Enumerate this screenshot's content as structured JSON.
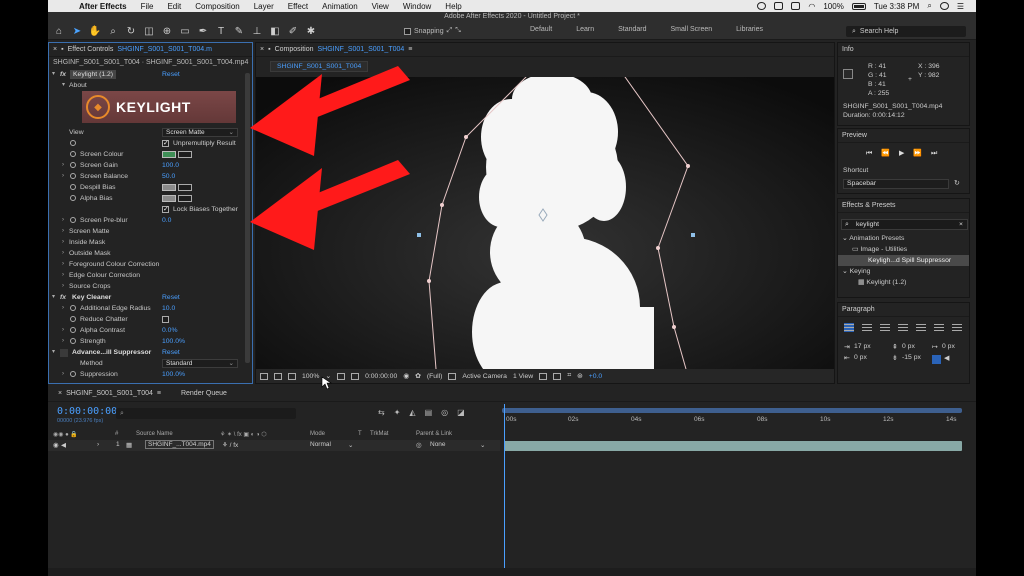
{
  "menubar": {
    "app_name": "After Effects",
    "items": [
      "File",
      "Edit",
      "Composition",
      "Layer",
      "Effect",
      "Animation",
      "View",
      "Window",
      "Help"
    ],
    "battery": "100%",
    "clock": "Tue 3:38 PM"
  },
  "window_title": "Adobe After Effects 2020 - Untitled Project *",
  "toolbar": {
    "snapping_label": "Snapping",
    "workspaces": [
      "Default",
      "Learn",
      "Standard",
      "Small Screen",
      "Libraries"
    ],
    "search_help_placeholder": "Search Help"
  },
  "effect_controls": {
    "header_label": "Effect Controls",
    "header_layer": "SHGINF_S001_S001_T004.m",
    "subheader": "SHGINF_S001_S001_T004 · SHGINF_S001_S001_T004.mp4",
    "keylight_name": "Keylight (1.2)",
    "reset_label": "Reset",
    "about_label": "About",
    "logo_text": "KEYLIGHT",
    "view_label": "View",
    "view_value": "Screen Matte",
    "unpremultiply_label": "Unpremultiply Result",
    "screen_colour_label": "Screen Colour",
    "screen_gain_label": "Screen Gain",
    "screen_gain_value": "100.0",
    "screen_balance_label": "Screen Balance",
    "screen_balance_value": "50.0",
    "despill_bias_label": "Despill Bias",
    "alpha_bias_label": "Alpha Bias",
    "lock_biases_label": "Lock Biases Together",
    "screen_preblur_label": "Screen Pre-blur",
    "screen_preblur_value": "0.0",
    "groups": [
      "Screen Matte",
      "Inside Mask",
      "Outside Mask",
      "Foreground Colour Correction",
      "Edge Colour Correction",
      "Source Crops"
    ],
    "key_cleaner_name": "Key Cleaner",
    "additional_edge_radius_label": "Additional Edge Radius",
    "additional_edge_radius_value": "10.0",
    "reduce_chatter_label": "Reduce Chatter",
    "alpha_contrast_label": "Alpha Contrast",
    "alpha_contrast_value": "0.0%",
    "strength_label": "Strength",
    "strength_value": "100.0%",
    "spill_suppressor_name": "Advance...ill Suppressor",
    "method_label": "Method",
    "method_value": "Standard",
    "suppression_label": "Suppression",
    "suppression_value": "100.0%"
  },
  "composition": {
    "header_label": "Composition",
    "header_comp": "SHGINF_S001_S001_T004",
    "tab_label": "SHGINF_S001_S001_T004",
    "zoom": "100%",
    "timecode": "0:00:00:00",
    "resolution": "(Full)",
    "camera": "Active Camera",
    "views": "1 View",
    "exposure": "+0.0"
  },
  "info": {
    "title": "Info",
    "r": "R : 41",
    "g": "G : 41",
    "b": "B : 41",
    "a": "A : 255",
    "x": "X : 396",
    "y": "Y : 982",
    "file": "SHGINF_S001_S001_T004.mp4",
    "duration": "Duration: 0:00:14:12"
  },
  "preview": {
    "title": "Preview",
    "shortcut_label": "Shortcut",
    "shortcut_value": "Spacebar"
  },
  "effects_presets": {
    "title": "Effects & Presets",
    "search_value": "keylight",
    "tree": [
      "Animation Presets",
      "Image - Utilities",
      "Keyligh...d Spill Suppressor",
      "Keying",
      "Keylight (1.2)"
    ]
  },
  "paragraph": {
    "title": "Paragraph",
    "indent_left": "17 px",
    "indent_right": "0 px",
    "space_before": "0 px",
    "first_line": "0 px",
    "space_after": "-15 px"
  },
  "timeline": {
    "tab_label": "SHGINF_S001_S001_T004",
    "render_queue_label": "Render Queue",
    "timecode": "0:00:00:00",
    "fps": "00000 (23.976 fps)",
    "columns": {
      "num": "#",
      "source": "Source Name",
      "mode": "Mode",
      "t": "T",
      "trkmat": "TrkMat",
      "parent": "Parent & Link"
    },
    "layer": {
      "index": "1",
      "name": "SHGINF_...T004.mp4",
      "mode": "Normal",
      "parent": "None"
    },
    "ruler_ticks": [
      "00s",
      "02s",
      "04s",
      "06s",
      "08s",
      "10s",
      "12s",
      "14s"
    ]
  },
  "colors": {
    "accent_blue": "#4a9fff",
    "panel_bg": "#232323",
    "arrow_red": "#ff1a1a"
  }
}
